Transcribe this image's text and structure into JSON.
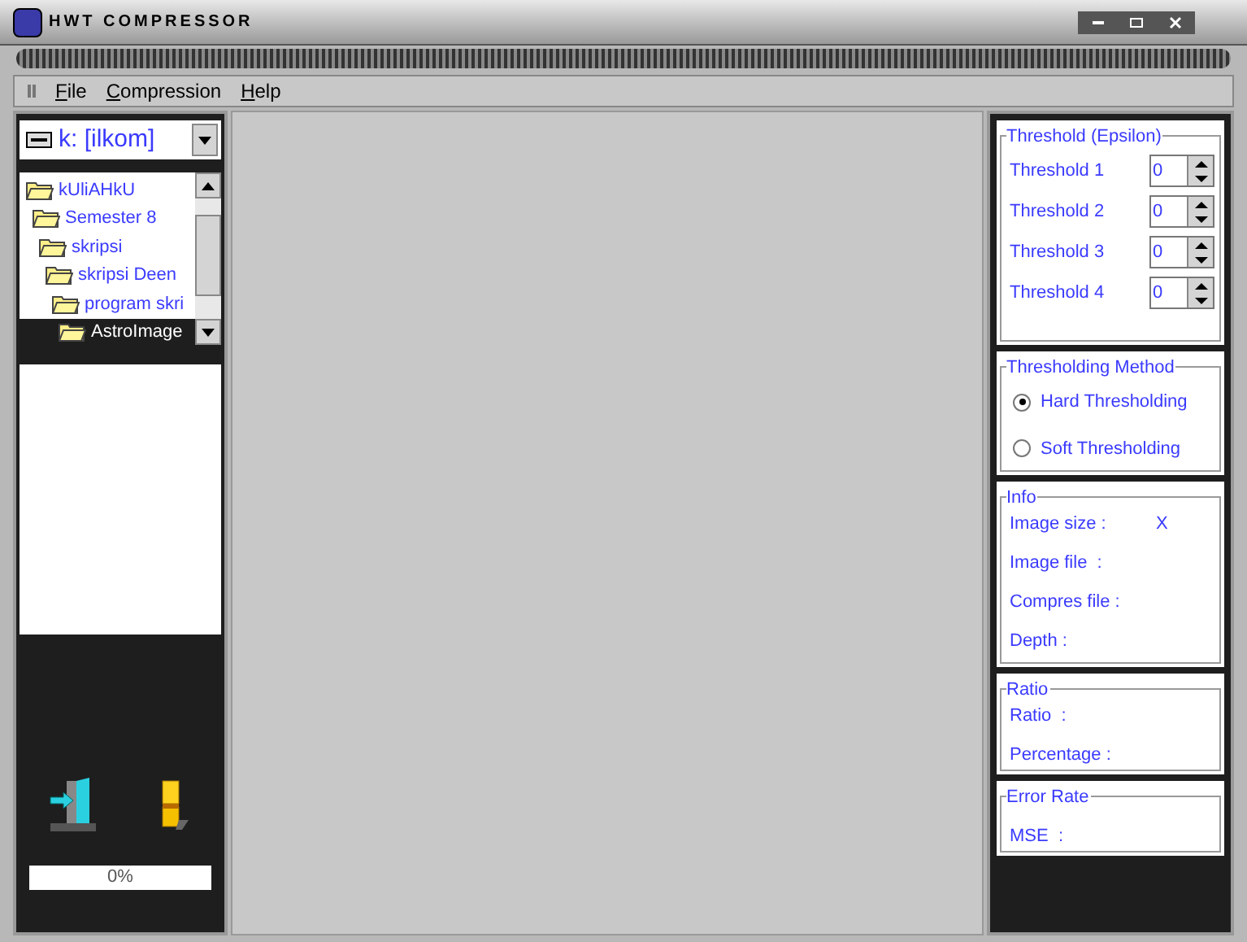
{
  "window": {
    "title": "HWT COMPRESSOR"
  },
  "menu": [
    {
      "label": "File"
    },
    {
      "label": "Compression"
    },
    {
      "label": "Help"
    }
  ],
  "drive": {
    "value": "k: [ilkom]"
  },
  "tree": [
    {
      "label": "kUliAHkU",
      "selected": false,
      "children": [
        {
          "label": "Semester 8",
          "selected": false,
          "children": [
            {
              "label": "skripsi",
              "selected": false,
              "children": [
                {
                  "label": "skripsi Deen",
                  "selected": false,
                  "children": [
                    {
                      "label": "program skri",
                      "selected": false,
                      "children": [
                        {
                          "label": "AstroImage",
                          "selected": true
                        }
                      ]
                    }
                  ]
                }
              ]
            }
          ]
        }
      ]
    }
  ],
  "progress": {
    "label": "0%"
  },
  "panels": [
    {
      "kind": "spinners",
      "title": "Threshold (Epsilon)",
      "items": [
        {
          "label": "Threshold 1",
          "value": "0"
        },
        {
          "label": "Threshold 2",
          "value": "0"
        },
        {
          "label": "Threshold 3",
          "value": "0"
        },
        {
          "label": "Threshold 4",
          "value": "0"
        }
      ]
    },
    {
      "kind": "radios",
      "title": "Thresholding Method",
      "items": [
        {
          "label": "Hard Thresholding",
          "selected": true
        },
        {
          "label": "Soft Thresholding",
          "selected": false
        }
      ]
    },
    {
      "kind": "rows",
      "title": "Info",
      "items": [
        {
          "label": "Image size :",
          "value": "X"
        },
        {
          "label": "Image file  :"
        },
        {
          "label": "Compres file :"
        },
        {
          "label": "Depth :"
        }
      ]
    },
    {
      "kind": "rows",
      "title": "Ratio",
      "items": [
        {
          "label": "Ratio  :"
        },
        {
          "label": "Percentage :"
        }
      ]
    },
    {
      "kind": "rows",
      "title": "Error Rate",
      "items": [
        {
          "label": "MSE  :"
        }
      ]
    }
  ]
}
